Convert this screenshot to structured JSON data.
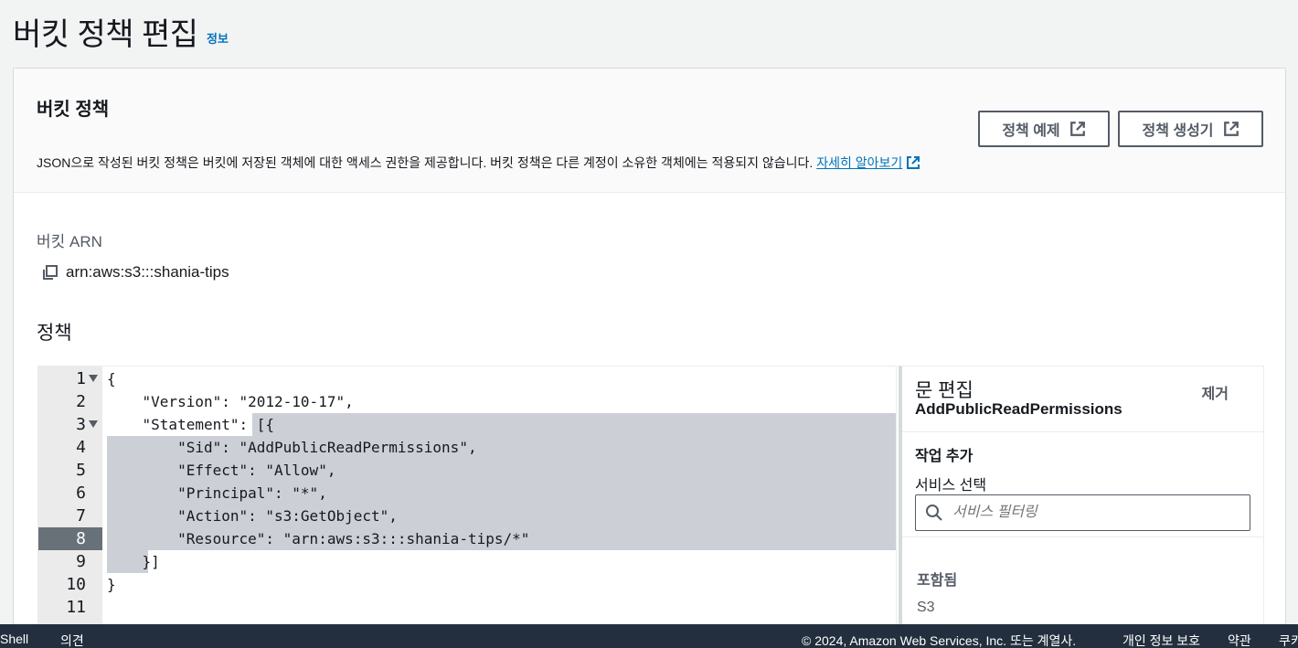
{
  "header": {
    "title": "버킷 정책 편집",
    "info": "정보"
  },
  "card": {
    "title": "버킷 정책",
    "description": "JSON으로 작성된 버킷 정책은 버킷에 저장된 객체에 대한 액세스 권한을 제공합니다. 버킷 정책은 다른 계정이 소유한 객체에는 적용되지 않습니다.",
    "learn_more": "자세히 알아보기",
    "btn_examples": "정책 예제",
    "btn_generator": "정책 생성기"
  },
  "arn": {
    "label": "버킷 ARN",
    "value": "arn:aws:s3:::shania-tips"
  },
  "policy": {
    "label": "정책",
    "line_numbers": [
      "1",
      "2",
      "3",
      "4",
      "5",
      "6",
      "7",
      "8",
      "9",
      "10",
      "11"
    ],
    "lines": [
      "{",
      "    \"Version\": \"2012-10-17\",",
      "    \"Statement\": [{",
      "        \"Sid\": \"AddPublicReadPermissions\",",
      "        \"Effect\": \"Allow\",",
      "        \"Principal\": \"*\",",
      "        \"Action\": \"s3:GetObject\",",
      "        \"Resource\": \"arn:aws:s3:::shania-tips/*\"",
      "    }]",
      "}",
      ""
    ],
    "active_line": "8"
  },
  "side_panel": {
    "title": "문 편집",
    "sid": "AddPublicReadPermissions",
    "remove": "제거",
    "add_action": "작업 추가",
    "select_service": "서비스 선택",
    "search_placeholder": "서비스 필터링",
    "included": "포함됨",
    "service": "S3"
  },
  "footer": {
    "shell": "Shell",
    "feedback": "의견",
    "copyright": "© 2024, Amazon Web Services, Inc. 또는 계열사.",
    "privacy": "개인 정보 보호",
    "terms": "약관",
    "cookies": "쿠키"
  },
  "colors": {
    "link": "#0073bb",
    "footer_bg": "#232f3e",
    "selection": "#ccd0d6",
    "active_line": "#687078"
  }
}
